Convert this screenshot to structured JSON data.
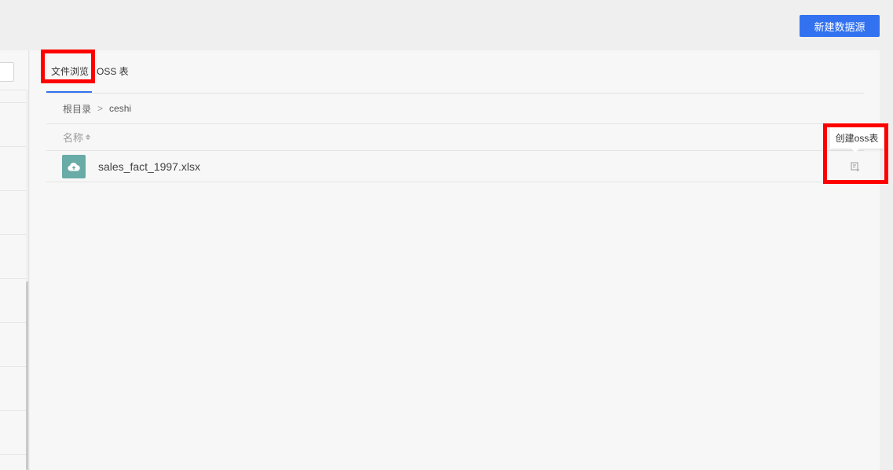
{
  "toolbar": {
    "new_datasource_label": "新建数据源"
  },
  "tabs": [
    {
      "label": "文件浏览",
      "active": true
    },
    {
      "label": "OSS 表",
      "active": false
    }
  ],
  "breadcrumb": {
    "root": "根目录",
    "separator": ">",
    "current": "ceshi"
  },
  "table": {
    "columns": [
      {
        "label": "名称",
        "sortable": true
      }
    ],
    "rows": [
      {
        "icon": "cloud-upload-icon",
        "name": "sales_fact_1997.xlsx",
        "action_icon": "create-table-icon"
      }
    ]
  },
  "tooltip": {
    "text": "创建oss表"
  },
  "colors": {
    "accent": "#3272f0",
    "file_icon_bg": "#69aba6",
    "highlight": "#ff0000"
  }
}
